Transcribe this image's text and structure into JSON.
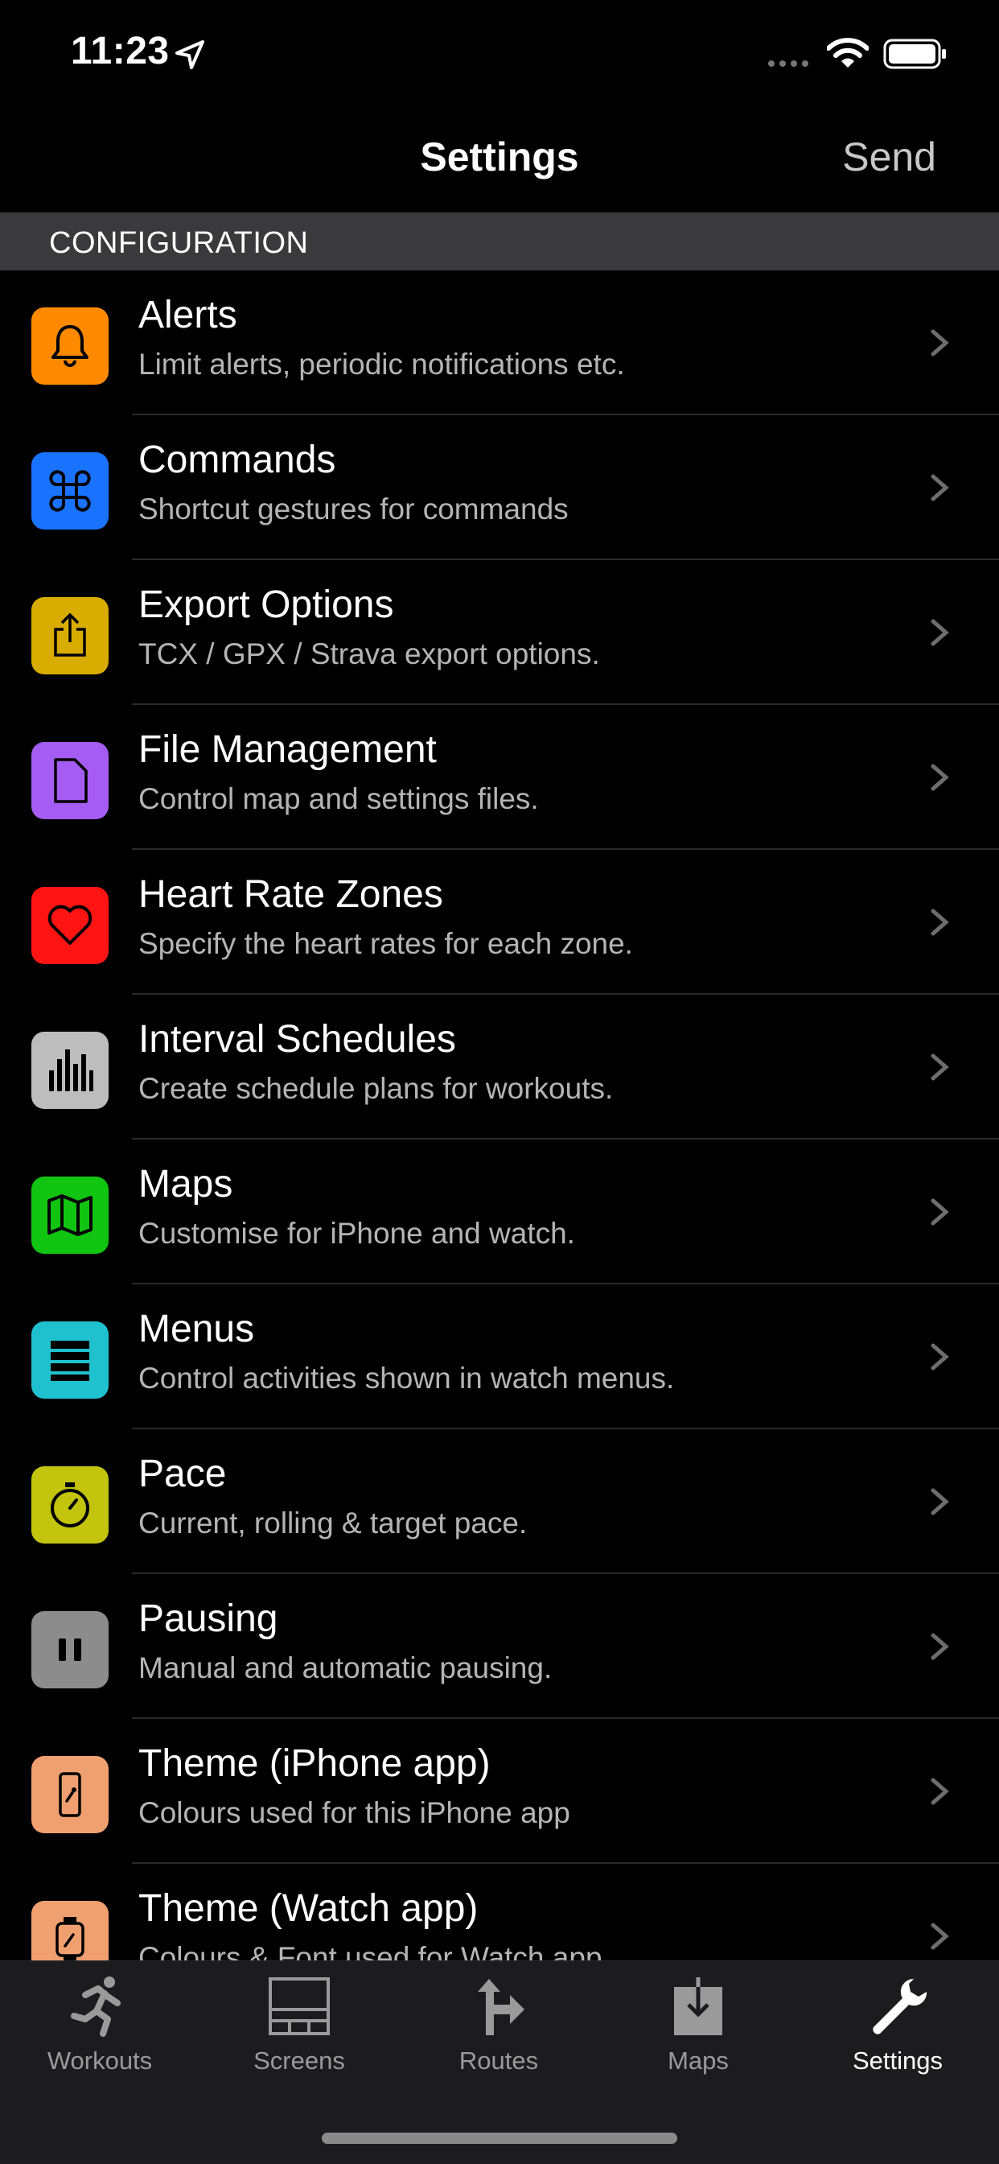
{
  "status_bar": {
    "time": "11:23"
  },
  "nav": {
    "title": "Settings",
    "send_label": "Send"
  },
  "section": {
    "header": "CONFIGURATION"
  },
  "settings": [
    {
      "title": "Alerts",
      "subtitle": "Limit alerts, periodic notifications etc.",
      "icon": "bell-icon",
      "color": "#ff8a00"
    },
    {
      "title": "Commands",
      "subtitle": "Shortcut gestures for commands",
      "icon": "command-icon",
      "color": "#1a73ff"
    },
    {
      "title": "Export Options",
      "subtitle": "TCX / GPX / Strava export options.",
      "icon": "share-icon",
      "color": "#d8ac00"
    },
    {
      "title": "File Management",
      "subtitle": "Control map and settings files.",
      "icon": "document-icon",
      "color": "#a45cf2"
    },
    {
      "title": "Heart Rate Zones",
      "subtitle": "Specify the heart rates for each zone.",
      "icon": "heart-icon",
      "color": "#ff1414"
    },
    {
      "title": "Interval Schedules",
      "subtitle": "Create schedule plans for workouts.",
      "icon": "bars-icon",
      "color": "#bdbdbd"
    },
    {
      "title": "Maps",
      "subtitle": "Customise for iPhone and watch.",
      "icon": "map-icon",
      "color": "#11c411"
    },
    {
      "title": "Menus",
      "subtitle": "Control activities shown in watch menus.",
      "icon": "menu-list-icon",
      "color": "#1fc1cf"
    },
    {
      "title": "Pace",
      "subtitle": "Current, rolling & target pace.",
      "icon": "stopwatch-icon",
      "color": "#c2c40d"
    },
    {
      "title": "Pausing",
      "subtitle": "Manual and automatic pausing.",
      "icon": "pause-icon",
      "color": "#8c8c8c"
    },
    {
      "title": "Theme (iPhone app)",
      "subtitle": "Colours used for this iPhone app",
      "icon": "phone-wrench-icon",
      "color": "#f0a070"
    },
    {
      "title": "Theme (Watch app)",
      "subtitle": "Colours & Font used for Watch app",
      "icon": "watch-wrench-icon",
      "color": "#f0a070"
    }
  ],
  "tabs": [
    {
      "label": "Workouts",
      "icon": "runner-icon",
      "active": false
    },
    {
      "label": "Screens",
      "icon": "screens-icon",
      "active": false
    },
    {
      "label": "Routes",
      "icon": "routes-icon",
      "active": false
    },
    {
      "label": "Maps",
      "icon": "map-download-icon",
      "active": false
    },
    {
      "label": "Settings",
      "icon": "wrench-icon",
      "active": true
    }
  ]
}
